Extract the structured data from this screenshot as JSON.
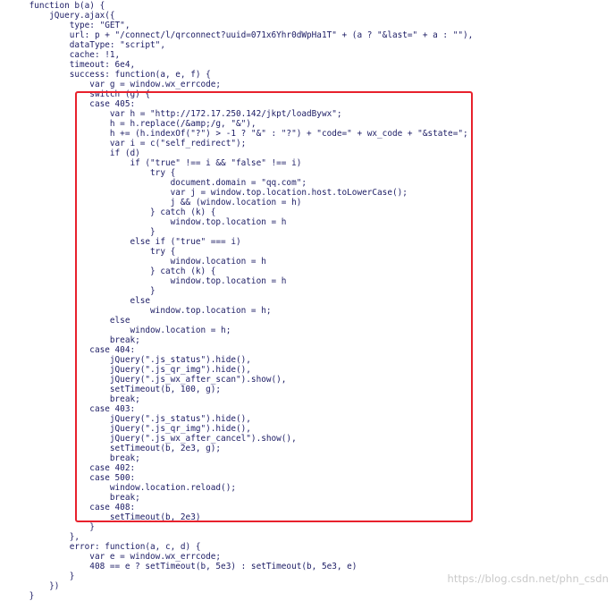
{
  "code": {
    "lines": [
      "    function b(a) {",
      "        jQuery.ajax({",
      "            type: \"GET\",",
      "            url: p + \"/connect/l/qrconnect?uuid=071x6Yhr0dWpHa1T\" + (a ? \"&last=\" + a : \"\"),",
      "            dataType: \"script\",",
      "            cache: !1,",
      "            timeout: 6e4,",
      "            success: function(a, e, f) {",
      "                var g = window.wx_errcode;",
      "                switch (g) {",
      "                case 405:",
      "                    var h = \"http://172.17.250.142/jkpt/loadBywx\";",
      "                    h = h.replace(/&amp;/g, \"&\"),",
      "                    h += (h.indexOf(\"?\") > -1 ? \"&\" : \"?\") + \"code=\" + wx_code + \"&state=\";",
      "                    var i = c(\"self_redirect\");",
      "                    if (d)",
      "                        if (\"true\" !== i && \"false\" !== i)",
      "                            try {",
      "                                document.domain = \"qq.com\";",
      "                                var j = window.top.location.host.toLowerCase();",
      "                                j && (window.location = h)",
      "                            } catch (k) {",
      "                                window.top.location = h",
      "                            }",
      "                        else if (\"true\" === i)",
      "                            try {",
      "                                window.location = h",
      "                            } catch (k) {",
      "                                window.top.location = h",
      "                            }",
      "                        else",
      "                            window.top.location = h;",
      "                    else",
      "                        window.location = h;",
      "                    break;",
      "                case 404:",
      "                    jQuery(\".js_status\").hide(),",
      "                    jQuery(\".js_qr_img\").hide(),",
      "                    jQuery(\".js_wx_after_scan\").show(),",
      "                    setTimeout(b, 100, g);",
      "                    break;",
      "                case 403:",
      "                    jQuery(\".js_status\").hide(),",
      "                    jQuery(\".js_qr_img\").hide(),",
      "                    jQuery(\".js_wx_after_cancel\").show(),",
      "                    setTimeout(b, 2e3, g);",
      "                    break;",
      "                case 402:",
      "                case 500:",
      "                    window.location.reload();",
      "                    break;",
      "                case 408:",
      "                    setTimeout(b, 2e3)",
      "                }",
      "            },",
      "            error: function(a, c, d) {",
      "                var e = window.wx_errcode;",
      "                408 == e ? setTimeout(b, 5e3) : setTimeout(b, 5e3, e)",
      "            }",
      "        })",
      "    }"
    ]
  },
  "watermark": {
    "text": "https://blog.csdn.net/phn_csdn"
  },
  "colors": {
    "code_text": "#1c1c64",
    "highlight_border": "#e8212c",
    "watermark": "#c9c9c9",
    "background": "#ffffff"
  }
}
